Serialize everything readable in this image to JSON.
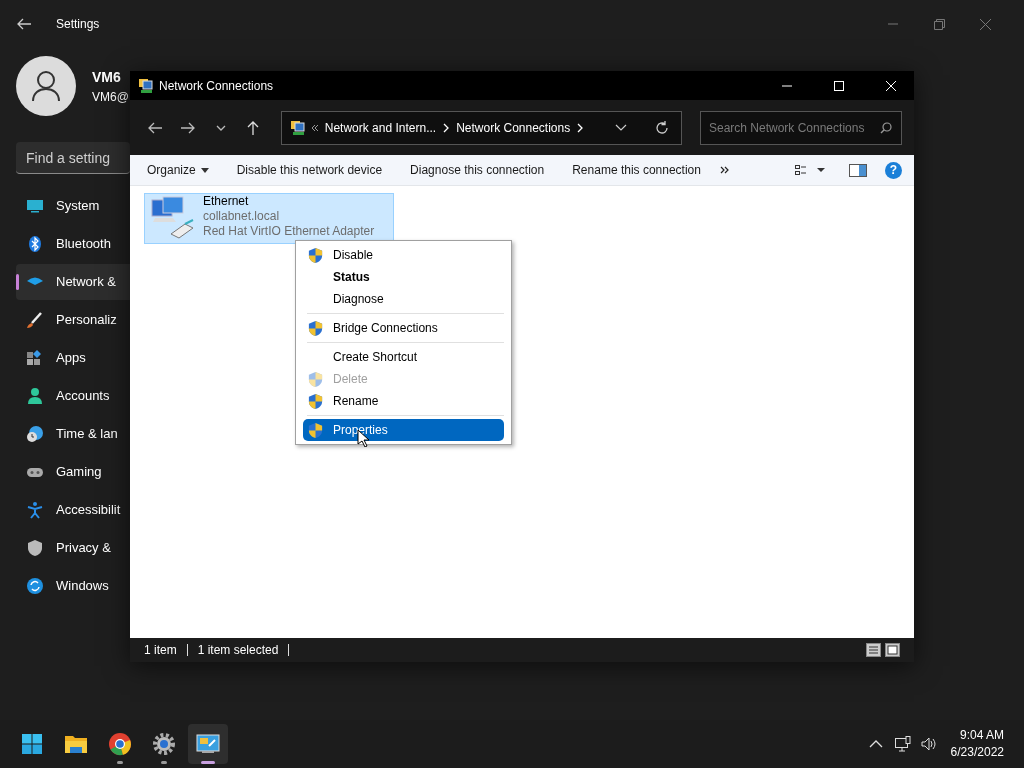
{
  "settings": {
    "title": "Settings",
    "profile": {
      "name": "VM6",
      "email": "VM6@"
    },
    "search": {
      "placeholder": "Find a setting"
    },
    "nav": [
      {
        "label": "System",
        "selected": false
      },
      {
        "label": "Bluetooth",
        "selected": false
      },
      {
        "label": "Network &",
        "selected": true
      },
      {
        "label": "Personaliz",
        "selected": false
      },
      {
        "label": "Apps",
        "selected": false
      },
      {
        "label": "Accounts",
        "selected": false
      },
      {
        "label": "Time & lan",
        "selected": false
      },
      {
        "label": "Gaming",
        "selected": false
      },
      {
        "label": "Accessibilit",
        "selected": false
      },
      {
        "label": "Privacy &",
        "selected": false
      },
      {
        "label": "Windows",
        "selected": false
      }
    ]
  },
  "explorer": {
    "title": "Network Connections",
    "address": [
      "Network and Intern...",
      "Network Connections"
    ],
    "search": {
      "placeholder": "Search Network Connections"
    },
    "toolbar": [
      {
        "label": "Organize",
        "dropdown": true
      },
      {
        "label": "Disable this network device",
        "dropdown": false
      },
      {
        "label": "Diagnose this connection",
        "dropdown": false
      },
      {
        "label": "Rename this connection",
        "dropdown": false
      }
    ],
    "help": "?",
    "items": [
      {
        "name": "Ethernet",
        "domain": "collabnet.local",
        "adapter": "Red Hat VirtIO Ethernet Adapter",
        "selected": true
      }
    ],
    "status": [
      "1 item",
      "1 item selected"
    ]
  },
  "context_menu": [
    [
      {
        "label": "Disable",
        "shield": true,
        "bold": false,
        "disabled": false,
        "selected": false
      },
      {
        "label": "Status",
        "shield": false,
        "bold": true,
        "disabled": false,
        "selected": false
      },
      {
        "label": "Diagnose",
        "shield": false,
        "bold": false,
        "disabled": false,
        "selected": false
      }
    ],
    [
      {
        "label": "Bridge Connections",
        "shield": true,
        "bold": false,
        "disabled": false,
        "selected": false
      }
    ],
    [
      {
        "label": "Create Shortcut",
        "shield": false,
        "bold": false,
        "disabled": false,
        "selected": false
      },
      {
        "label": "Delete",
        "shield": true,
        "bold": false,
        "disabled": true,
        "selected": false
      },
      {
        "label": "Rename",
        "shield": true,
        "bold": false,
        "disabled": false,
        "selected": false
      }
    ],
    [
      {
        "label": "Properties",
        "shield": true,
        "bold": false,
        "disabled": false,
        "selected": true
      }
    ]
  ],
  "taskbar": {
    "apps": [
      {
        "kind": "start",
        "running": false,
        "active": false
      },
      {
        "kind": "folder",
        "running": false,
        "active": false
      },
      {
        "kind": "browser",
        "running": true,
        "active": false
      },
      {
        "kind": "gear",
        "running": true,
        "active": false
      },
      {
        "kind": "network",
        "running": true,
        "active": true
      }
    ],
    "time": "9:04 AM",
    "date": "6/23/2022"
  }
}
